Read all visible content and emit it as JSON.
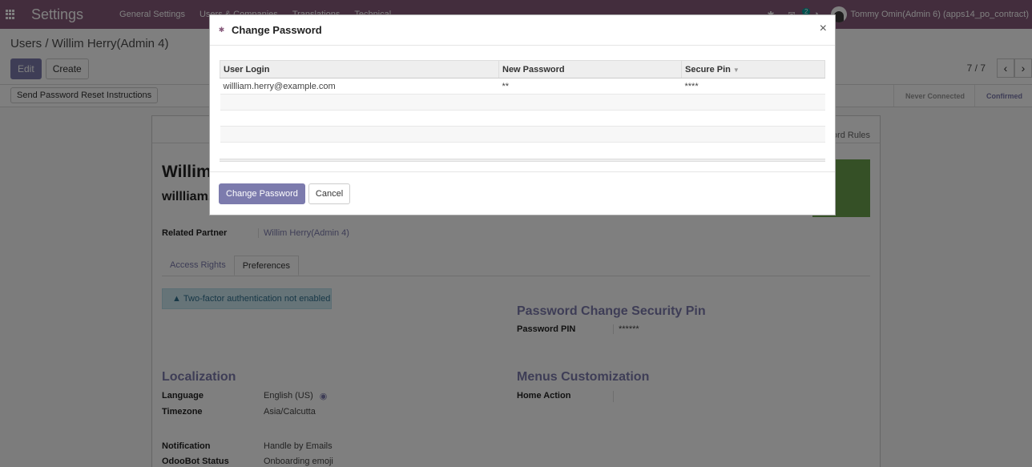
{
  "navbar": {
    "brand": "Settings",
    "menu": [
      "General Settings",
      "Users & Companies",
      "Translations",
      "Technical"
    ],
    "message_count": "2",
    "user": "Tommy Omin(Admin 6) (apps14_po_contract)"
  },
  "control": {
    "breadcrumb_parent": "Users",
    "breadcrumb_sep": "/",
    "breadcrumb_current": "Willim Herry(Admin 4)",
    "edit_label": "Edit",
    "create_label": "Create",
    "pager_value": "7 / 7"
  },
  "statusbar": {
    "reset_label": "Send Password Reset Instructions",
    "stages": [
      "Never Connected",
      "Confirmed"
    ]
  },
  "form": {
    "record_rules": "ord Rules",
    "title": "Willim",
    "login": "willliam.",
    "related_partner_label": "Related Partner",
    "related_partner_value": "Willim Herry(Admin 4)",
    "tabs": [
      "Access Rights",
      "Preferences"
    ],
    "alert": "Two-factor authentication not enabled",
    "pin_section_title": "Password Change Security Pin",
    "pin_label": "Password PIN",
    "pin_value": "******",
    "localization_title": "Localization",
    "language_label": "Language",
    "language_value": "English (US)",
    "timezone_label": "Timezone",
    "timezone_value": "Asia/Calcutta",
    "menus_title": "Menus Customization",
    "home_action_label": "Home Action",
    "notification_label": "Notification",
    "notification_value": "Handle by Emails",
    "odoobot_label": "OdooBot Status",
    "odoobot_value": "Onboarding emoji"
  },
  "modal": {
    "title": "Change Password",
    "columns": [
      "User Login",
      "New Password",
      "Secure Pin"
    ],
    "rows": [
      {
        "login": "willliam.herry@example.com",
        "new_password": "**",
        "secure_pin": "****"
      }
    ],
    "primary_button": "Change Password",
    "cancel_button": "Cancel"
  },
  "colors": {
    "navbar": "#875a7b",
    "primary": "#7c7bad",
    "photo": "#6ba14c"
  }
}
